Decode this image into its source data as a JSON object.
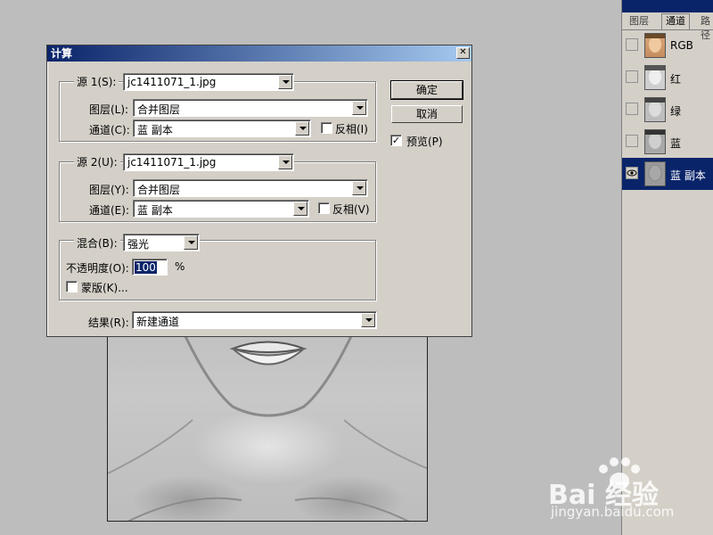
{
  "dialog": {
    "title": "计算",
    "close_label": "✕",
    "source1": {
      "legend": "源 1(S):",
      "file": "jc1411071_1.jpg",
      "layer_label": "图层(L):",
      "layer_value": "合并图层",
      "channel_label": "通道(C):",
      "channel_value": "蓝 副本",
      "invert_label": "反相(I)",
      "invert_checked": false
    },
    "source2": {
      "legend": "源 2(U):",
      "file": "jc1411071_1.jpg",
      "layer_label": "图层(Y):",
      "layer_value": "合并图层",
      "channel_label": "通道(E):",
      "channel_value": "蓝 副本",
      "invert_label": "反相(V)",
      "invert_checked": false
    },
    "blend": {
      "legend": "混合(B):",
      "mode_value": "强光",
      "opacity_label": "不透明度(O):",
      "opacity_value": "100",
      "opacity_unit": "%",
      "mask_label": "蒙版(K)...",
      "mask_checked": false
    },
    "result": {
      "label": "结果(R):",
      "value": "新建通道"
    },
    "buttons": {
      "ok": "确定",
      "cancel": "取消",
      "preview_label": "预览(P)",
      "preview_checked": true
    }
  },
  "channels_panel": {
    "tabs": [
      "图层",
      "通道",
      "路径"
    ],
    "active_tab": "通道",
    "channels": [
      {
        "label": "RGB",
        "visible": false,
        "selected": false
      },
      {
        "label": "红",
        "visible": false,
        "selected": false
      },
      {
        "label": "绿",
        "visible": false,
        "selected": false
      },
      {
        "label": "蓝",
        "visible": false,
        "selected": false
      },
      {
        "label": "蓝 副本",
        "visible": true,
        "selected": true
      }
    ]
  },
  "watermark": {
    "brand": "Bai 经验",
    "url": "jingyan.baidu.com"
  },
  "colors": {
    "selection": "#0a246a",
    "dialog_bg": "#d4d0c8"
  }
}
